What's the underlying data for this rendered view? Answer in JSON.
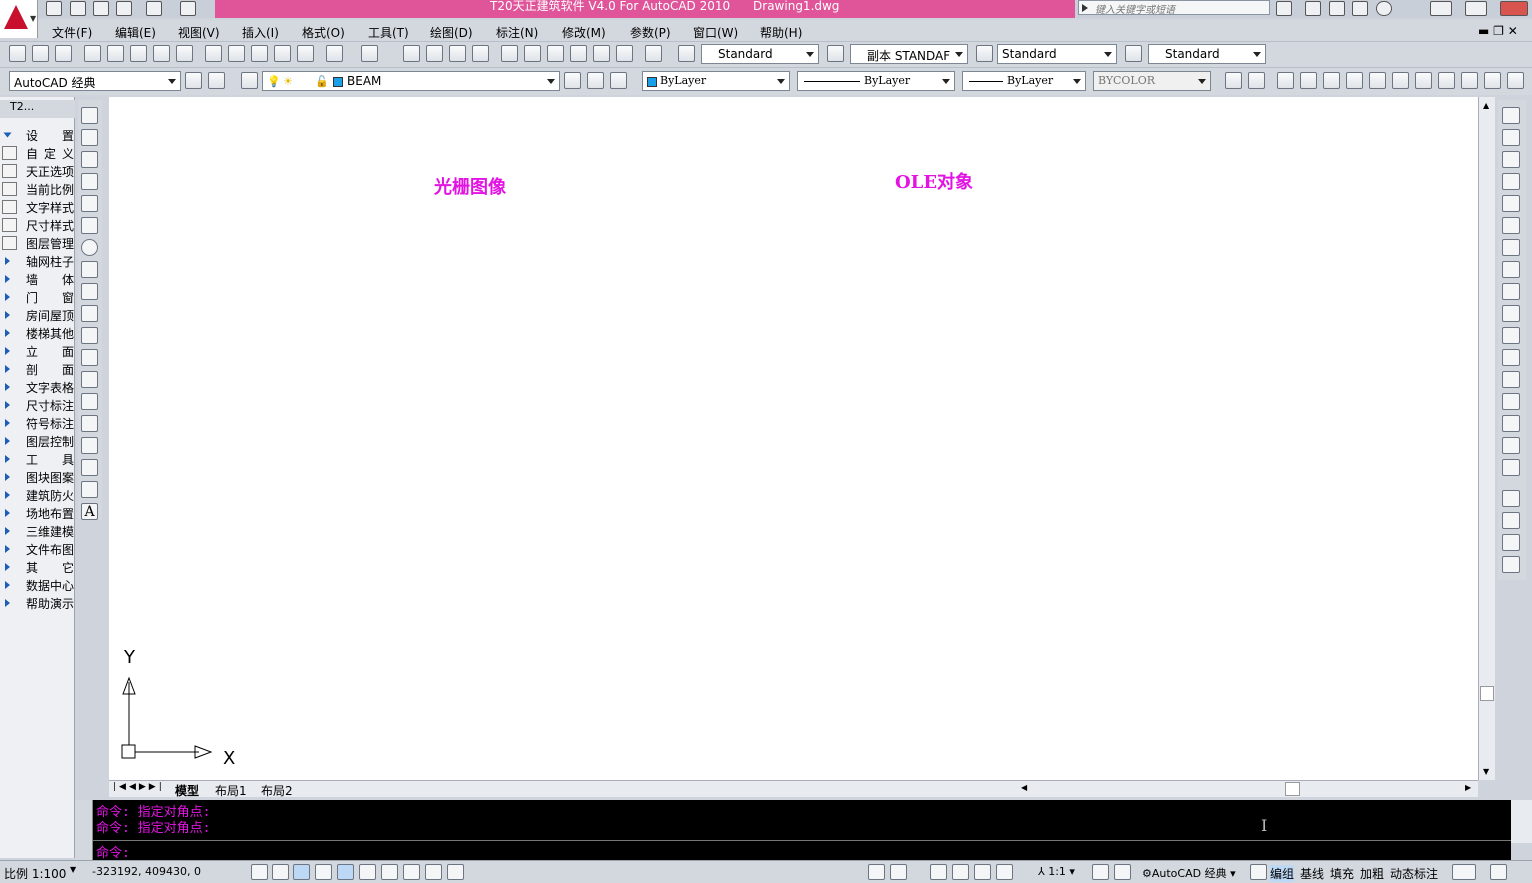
{
  "window": {
    "title": "T20天正建筑软件 V4.0 For AutoCAD 2010",
    "document": "Drawing1.dwg",
    "search_placeholder": "键入关键字或短语"
  },
  "menu": [
    "文件(F)",
    "编辑(E)",
    "视图(V)",
    "插入(I)",
    "格式(O)",
    "工具(T)",
    "绘图(D)",
    "标注(N)",
    "修改(M)",
    "参数(P)",
    "窗口(W)",
    "帮助(H)"
  ],
  "styles_toolbar": {
    "text_style": "Standard",
    "dim_style": "副本 STANDAF",
    "table_style": "Standard",
    "multileader_style": "Standard"
  },
  "layers_toolbar": {
    "workspace": "AutoCAD 经典",
    "layer": "BEAM",
    "color": "ByLayer",
    "linetype": "ByLayer",
    "lineweight": "ByLayer",
    "plotstyle": "BYCOLOR",
    "layer_color": "#1aa0e8"
  },
  "left_panel": {
    "title": "T2...",
    "items": [
      "设　置",
      "自定义",
      "天正选项",
      "当前比例",
      "文字样式",
      "尺寸样式",
      "图层管理",
      "轴网柱子",
      "墙　体",
      "门　窗",
      "房间屋顶",
      "楼梯其他",
      "立　面",
      "剖　面",
      "文字表格",
      "尺寸标注",
      "符号标注",
      "图层控制",
      "工　具",
      "图块图案",
      "建筑防火",
      "场地布置",
      "三维建模",
      "文件布图",
      "其　它",
      "数据中心",
      "帮助演示"
    ]
  },
  "canvas": {
    "label_raster": "光栅图像",
    "label_ole": "OLE对象",
    "axis_x": "X",
    "axis_y": "Y",
    "accent": "#e313e3"
  },
  "tabs": [
    "模型",
    "布局1",
    "布局2"
  ],
  "command": {
    "history": [
      "命令: 指定对角点:",
      "命令: 指定对角点:"
    ],
    "prompt": "命令:"
  },
  "status": {
    "scale": "比例 1:100",
    "coords": "-323192, 409430, 0",
    "annotation_scale": "1:1",
    "workspace": "AutoCAD 经典",
    "toggles": [
      "编组",
      "基线",
      "填充",
      "加粗",
      "动态标注"
    ]
  }
}
